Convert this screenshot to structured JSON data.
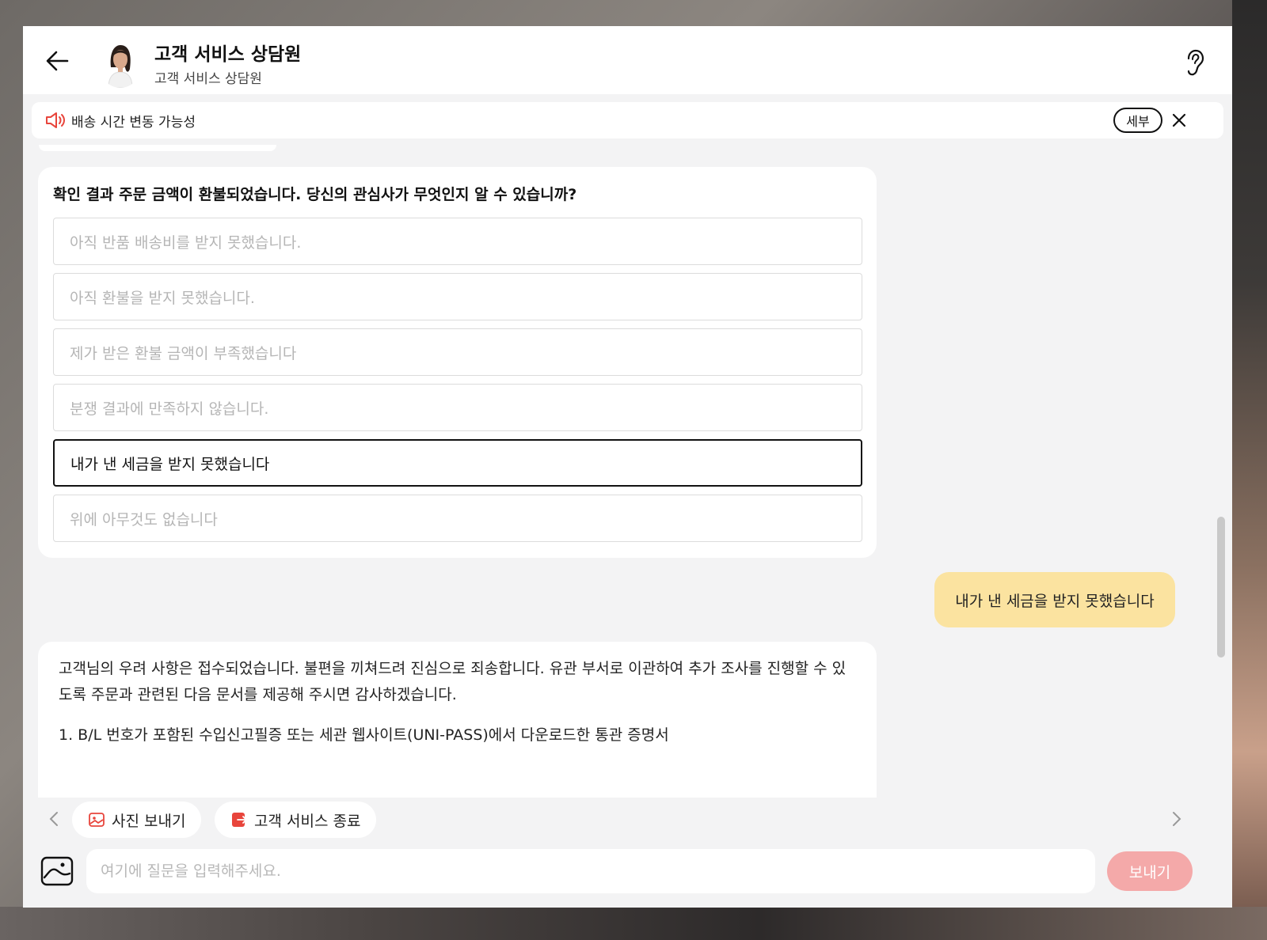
{
  "header": {
    "title": "고객 서비스 상담원",
    "subtitle": "고객 서비스 상담원"
  },
  "notice": {
    "text": "배송 시간 변동 가능성",
    "detail_label": "세부"
  },
  "survey": {
    "question": "확인 결과 주문 금액이 환불되었습니다. 당신의 관심사가 무엇인지 알 수 있습니까?",
    "options": [
      "아직 반품 배송비를 받지 못했습니다.",
      "아직 환불을 받지 못했습니다.",
      "제가 받은 환불 금액이 부족했습니다",
      "분쟁 결과에 만족하지 않습니다.",
      "내가 낸 세금을 받지 못했습니다",
      "위에 아무것도 없습니다"
    ],
    "selected_index": 4
  },
  "user_message": "내가 낸 세금을 받지 못했습니다",
  "agent_reply": {
    "paragraph": "고객님의 우려 사항은 접수되었습니다. 불편을 끼쳐드려 진심으로 죄송합니다. 유관 부서로 이관하여 추가 조사를 진행할 수 있도록 주문과 관련된 다음 문서를 제공해 주시면 감사하겠습니다.",
    "item1": "1. B/L 번호가 포함된 수입신고필증 또는 세관 웹사이트(UNI-PASS)에서 다운로드한 통관 증명서"
  },
  "quick_actions": {
    "send_photo": "사진 보내기",
    "end_service": "고객 서비스 종료"
  },
  "input": {
    "placeholder": "여기에 질문을 입력해주세요.",
    "send_label": "보내기"
  },
  "colors": {
    "user_bubble": "#fbe3a0",
    "send_button": "#f4a9a9",
    "accent_red": "#e8453c"
  }
}
